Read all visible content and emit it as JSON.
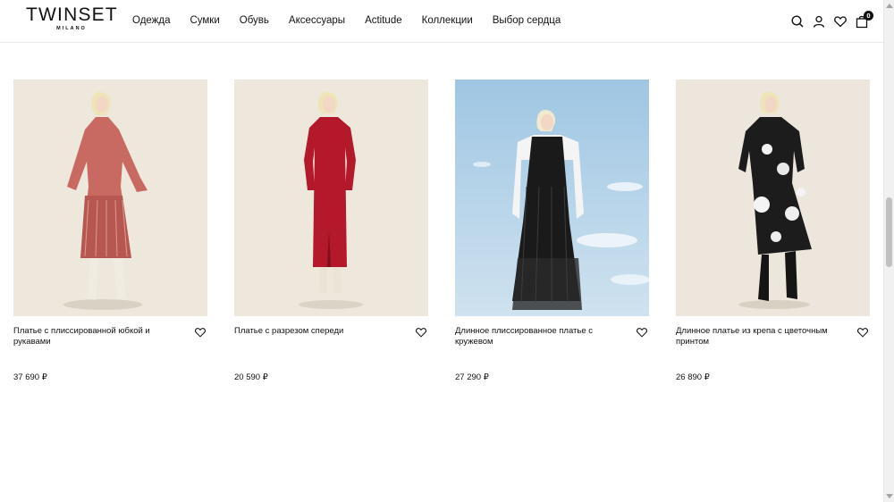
{
  "brand": {
    "name": "TWINSET",
    "sub": "MILANO"
  },
  "nav": [
    {
      "label": "Одежда"
    },
    {
      "label": "Сумки"
    },
    {
      "label": "Обувь"
    },
    {
      "label": "Аксессуары"
    },
    {
      "label": "Actitude"
    },
    {
      "label": "Коллекции"
    },
    {
      "label": "Выбор сердца"
    }
  ],
  "header_icons": [
    "search-icon",
    "user-icon",
    "heart-icon",
    "bag-icon"
  ],
  "cart": {
    "count": "0"
  },
  "products": [
    {
      "title": "Платье с плиссированной юбкой и рукавами",
      "price": "37 690 ₽",
      "dress_color": "#c96a62",
      "bg": "#ede7dc"
    },
    {
      "title": "Платье с разрезом спереди",
      "price": "20 590 ₽",
      "dress_color": "#b3182b",
      "bg": "#eee7dc"
    },
    {
      "title": "Длинное плиссированное платье с кружевом",
      "price": "27 290 ₽",
      "dress_color": "#1a1a1a",
      "bg": "#a9cce6"
    },
    {
      "title": "Длинное платье из крепа с цветочным принтом",
      "price": "26 890 ₽",
      "dress_color": "#1c1c1c",
      "bg": "#ece6dc"
    }
  ]
}
